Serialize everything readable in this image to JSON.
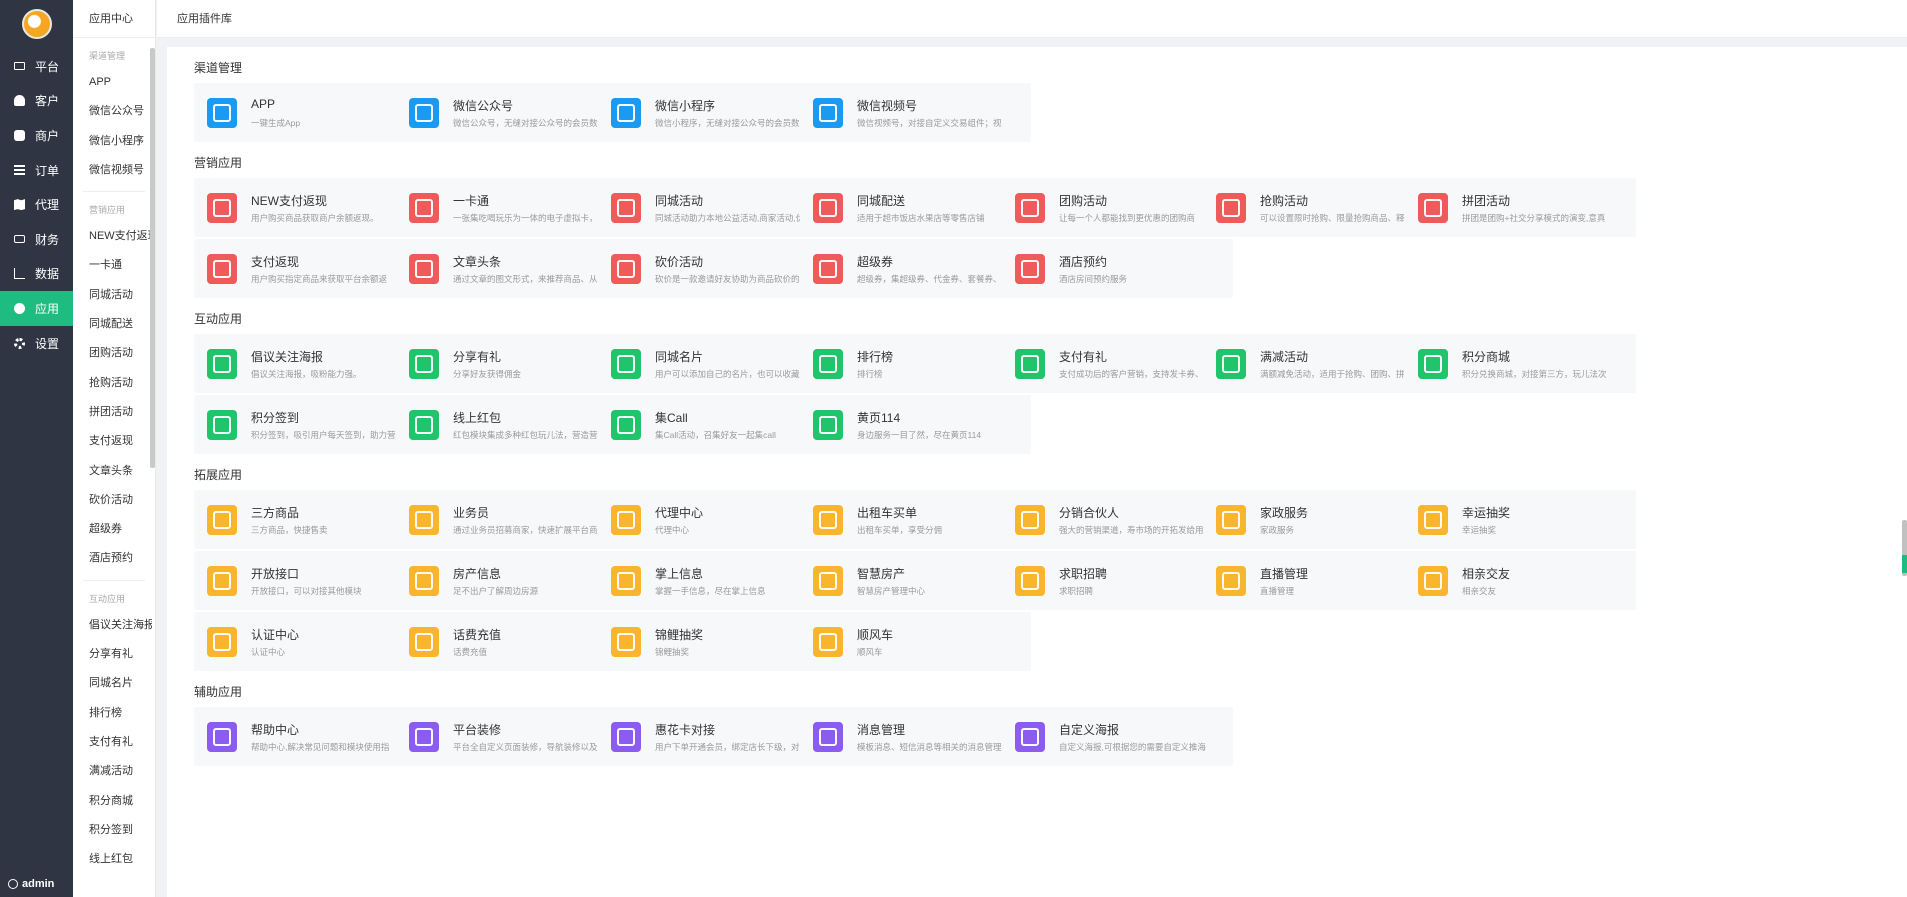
{
  "nav": {
    "items": [
      {
        "label": "平台",
        "icon": "monitor-icon"
      },
      {
        "label": "客户",
        "icon": "user-icon"
      },
      {
        "label": "商户",
        "icon": "users-icon"
      },
      {
        "label": "订单",
        "icon": "list-icon"
      },
      {
        "label": "代理",
        "icon": "map-icon"
      },
      {
        "label": "财务",
        "icon": "money-icon"
      },
      {
        "label": "数据",
        "icon": "chart-icon"
      },
      {
        "label": "应用",
        "icon": "app-icon",
        "active": true
      },
      {
        "label": "设置",
        "icon": "gear-icon"
      }
    ],
    "user": "admin",
    "active_color": "#1fbc82"
  },
  "sub": {
    "title": "应用中心",
    "groups": [
      {
        "label": "渠道管理",
        "items": [
          "APP",
          "微信公众号",
          "微信小程序",
          "微信视频号"
        ]
      },
      {
        "label": "营销应用",
        "items": [
          "NEW支付返现",
          "一卡通",
          "同城活动",
          "同城配送",
          "团购活动",
          "抢购活动",
          "拼团活动",
          "支付返现",
          "文章头条",
          "砍价活动",
          "超级券",
          "酒店预约"
        ]
      },
      {
        "label": "互动应用",
        "items": [
          "倡议关注海报",
          "分享有礼",
          "同城名片",
          "排行榜",
          "支付有礼",
          "满减活动",
          "积分商城",
          "积分签到",
          "线上红包"
        ]
      }
    ]
  },
  "header": {
    "breadcrumb": "应用插件库"
  },
  "sections": [
    {
      "title": "渠道管理",
      "color": "blue",
      "cards": [
        {
          "title": "APP",
          "desc": "一键生成App",
          "icon": "grid-icon"
        },
        {
          "title": "微信公众号",
          "desc": "微信公众号，无缝对接公众号的会员数",
          "icon": "wechat-icon"
        },
        {
          "title": "微信小程序",
          "desc": "微信小程序，无缝对接公众号的会员数",
          "icon": "miniprogram-icon"
        },
        {
          "title": "微信视频号",
          "desc": "微信视频号，对接自定义交易组件；视",
          "icon": "video-channel-icon"
        }
      ]
    },
    {
      "title": "营销应用",
      "color": "red",
      "cards": [
        {
          "title": "NEW支付返现",
          "desc": "用户购买商品获取商户余额返现。",
          "icon": "moneybag-icon"
        },
        {
          "title": "一卡通",
          "desc": "一张集吃喝玩乐为一体的电子虚拟卡，",
          "icon": "card-icon"
        },
        {
          "title": "同城活动",
          "desc": "同城活动助力本地公益活动,商家活动,优",
          "icon": "megaphone-icon"
        },
        {
          "title": "同城配送",
          "desc": "适用于超市饭店水果店等零售店铺",
          "icon": "scooter-icon"
        },
        {
          "title": "团购活动",
          "desc": "让每一个人都能找到更优惠的团购商",
          "icon": "group-buy-icon"
        },
        {
          "title": "抢购活动",
          "desc": "可以设置限时抢购、限量抢购商品、释",
          "icon": "timer-icon"
        },
        {
          "title": "拼团活动",
          "desc": "拼团是团购+社交分享模式的演变,意真",
          "icon": "team-icon"
        },
        {
          "title": "支付返现",
          "desc": "用户购买指定商品来获取平台余额返",
          "icon": "moneybag-icon"
        },
        {
          "title": "文章头条",
          "desc": "通过文章的图文形式，来推荐商品、从",
          "icon": "article-icon"
        },
        {
          "title": "砍价活动",
          "desc": "砍价是一款邀请好友协助为商品砍价的",
          "icon": "bargain-icon"
        },
        {
          "title": "超级券",
          "desc": "超级券，集超级券、代金券、套餐券、",
          "icon": "coupon-icon"
        },
        {
          "title": "酒店预约",
          "desc": "酒店房间预约服务",
          "icon": "hotel-icon"
        }
      ]
    },
    {
      "title": "互动应用",
      "color": "green",
      "cards": [
        {
          "title": "倡议关注海报",
          "desc": "倡议关注海报，吸粉能力强。",
          "icon": "heart-icon"
        },
        {
          "title": "分享有礼",
          "desc": "分享好友获得佣金",
          "icon": "share-icon"
        },
        {
          "title": "同城名片",
          "desc": "用户可以添加自己的名片，也可以收藏",
          "icon": "namecard-icon"
        },
        {
          "title": "排行榜",
          "desc": "排行榜",
          "icon": "trophy-icon"
        },
        {
          "title": "支付有礼",
          "desc": "支付成功后的客户营销，支持发卡券、",
          "icon": "gift-icon"
        },
        {
          "title": "满减活动",
          "desc": "满额减免活动，适用于抢购、团购、拼",
          "icon": "tag-icon"
        },
        {
          "title": "积分商城",
          "desc": "积分兑换商城，对接第三方，玩儿法次",
          "icon": "shop-icon"
        },
        {
          "title": "积分签到",
          "desc": "积分签到，吸引用户每天签到，助力营",
          "icon": "calendar-icon"
        },
        {
          "title": "线上红包",
          "desc": "红包模块集成多种红包玩儿法，营造营",
          "icon": "redpacket-icon"
        },
        {
          "title": "集Call",
          "desc": "集Call活动，召集好友一起集call",
          "icon": "call-icon"
        },
        {
          "title": "黄页114",
          "desc": "身边服务一目了然，尽在黄页114",
          "icon": "yellowpage-icon"
        }
      ]
    },
    {
      "title": "拓展应用",
      "color": "orange",
      "cards": [
        {
          "title": "三方商品",
          "desc": "三方商品，快捷售卖",
          "icon": "goods-icon"
        },
        {
          "title": "业务员",
          "desc": "通过业务员招募商家，快速扩展平台商",
          "icon": "salesman-icon"
        },
        {
          "title": "代理中心",
          "desc": "代理中心",
          "icon": "agent-icon"
        },
        {
          "title": "出租车买单",
          "desc": "出租车买单，享受分佣",
          "icon": "taxi-icon"
        },
        {
          "title": "分销合伙人",
          "desc": "强大的营销渠道，寿市场的开拓发给用",
          "icon": "partner-icon"
        },
        {
          "title": "家政服务",
          "desc": "家政服务",
          "icon": "housekeeping-icon"
        },
        {
          "title": "幸运抽奖",
          "desc": "幸运抽奖",
          "icon": "lottery-icon"
        },
        {
          "title": "开放接口",
          "desc": "开放接口，可以对接其他模块",
          "icon": "api-icon"
        },
        {
          "title": "房产信息",
          "desc": "足不出户了解周边房源",
          "icon": "house-icon"
        },
        {
          "title": "掌上信息",
          "desc": "掌握一手信息，尽在掌上信息",
          "icon": "message-icon"
        },
        {
          "title": "智慧房产",
          "desc": "智慧房产管理中心",
          "icon": "smart-house-icon"
        },
        {
          "title": "求职招聘",
          "desc": "求职招聘",
          "icon": "briefcase-icon"
        },
        {
          "title": "直播管理",
          "desc": "直播管理",
          "icon": "live-icon"
        },
        {
          "title": "相亲交友",
          "desc": "相亲交友",
          "icon": "dating-icon"
        },
        {
          "title": "认证中心",
          "desc": "认证中心",
          "icon": "shield-icon"
        },
        {
          "title": "话费充值",
          "desc": "话费充值",
          "icon": "phone-icon"
        },
        {
          "title": "锦鲤抽奖",
          "desc": "锦鲤抽奖",
          "icon": "koi-icon"
        },
        {
          "title": "顺风车",
          "desc": "顺风车",
          "icon": "car-icon"
        }
      ]
    },
    {
      "title": "辅助应用",
      "color": "purple",
      "cards": [
        {
          "title": "帮助中心",
          "desc": "帮助中心,解决常见问题和模块使用指",
          "icon": "book-icon"
        },
        {
          "title": "平台装修",
          "desc": "平台全自定义页面装修，导航装修以及",
          "icon": "palette-icon"
        },
        {
          "title": "惠花卡对接",
          "desc": "用户下单开通会员，绑定店长下级，对",
          "icon": "palette-icon"
        },
        {
          "title": "消息管理",
          "desc": "模板消息、短信消息等相关的消息管理",
          "icon": "chat-icon"
        },
        {
          "title": "自定义海报",
          "desc": "自定义海报,可根据您的需要自定义推海",
          "icon": "image-icon"
        }
      ]
    }
  ]
}
